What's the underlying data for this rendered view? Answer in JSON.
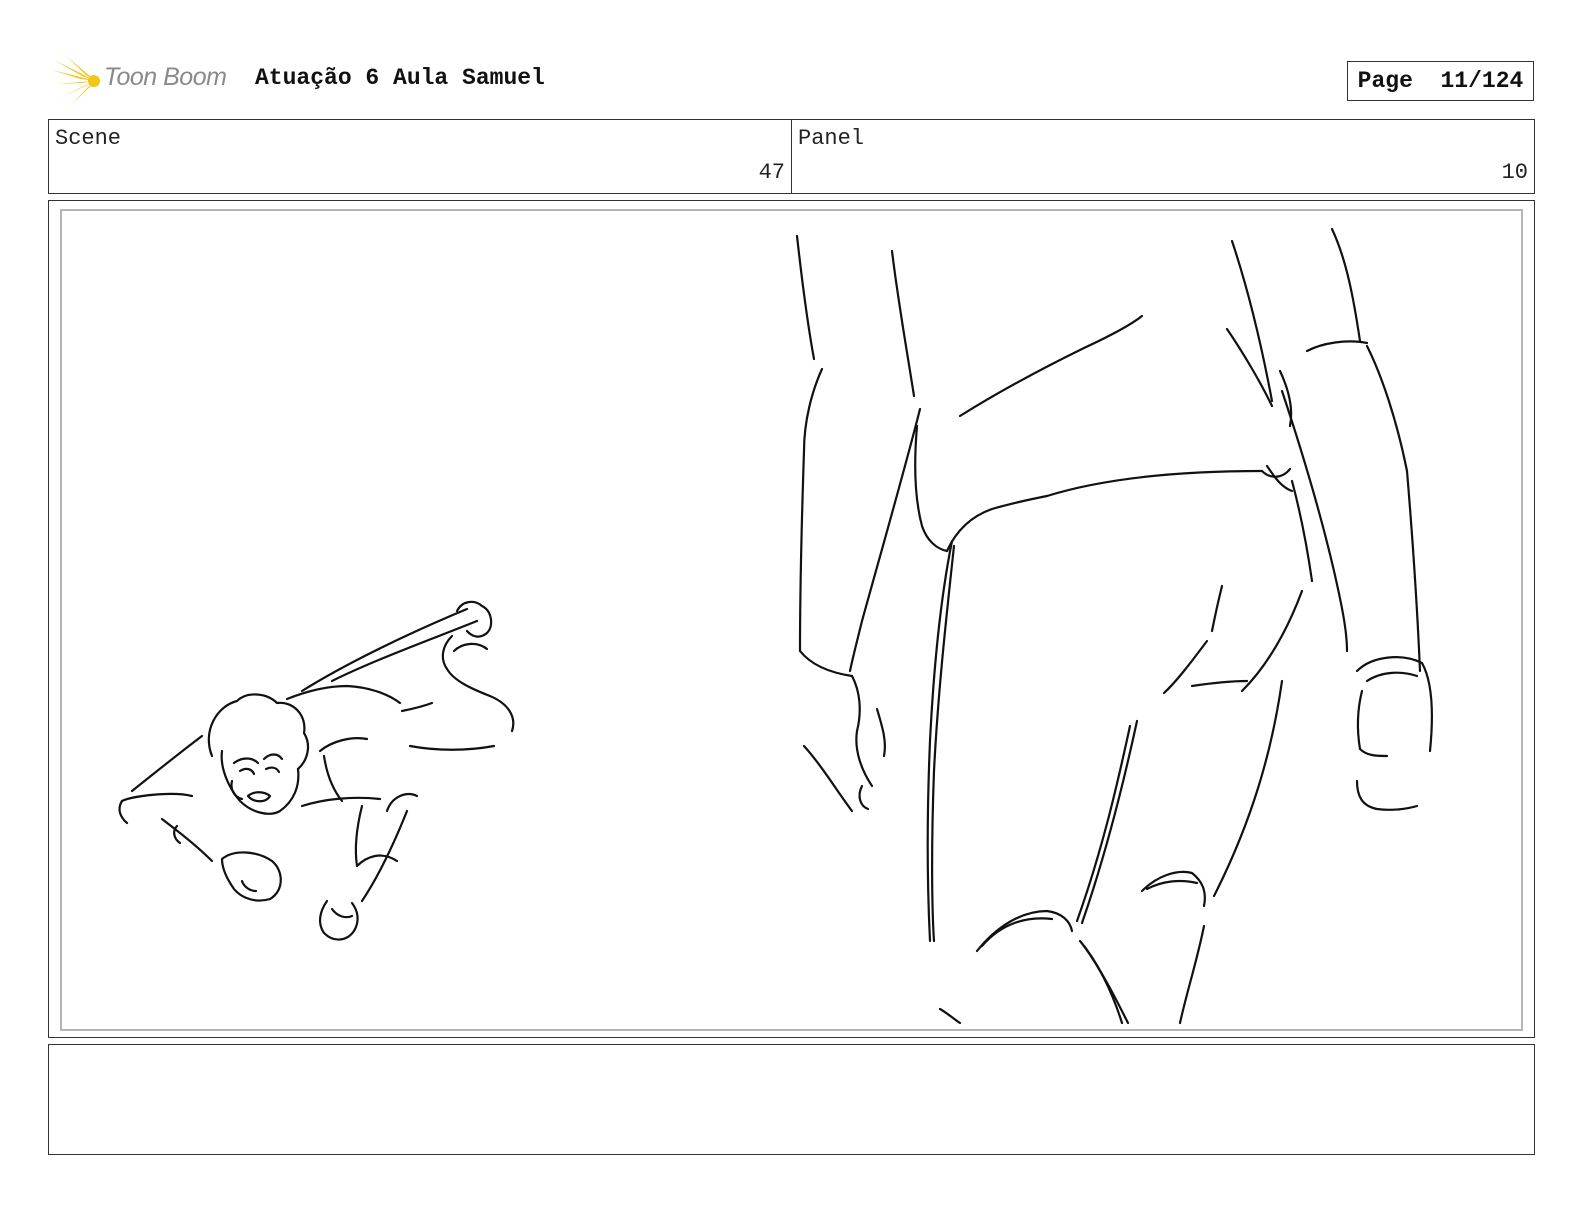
{
  "header": {
    "logo_text": "Toon Boom",
    "title": "Atuação 6 Aula Samuel",
    "page_label": "Page",
    "page_value": "11/124"
  },
  "info": {
    "scene_label": "Scene",
    "scene_value": "47",
    "panel_label": "Panel",
    "panel_value": "10"
  },
  "notes": {
    "text": ""
  },
  "colors": {
    "logo_accent": "#f5c518",
    "ink": "#111111",
    "frame_border": "#333333",
    "inner_border": "#b5b5b5"
  },
  "icons": {
    "logo": "toon-boom-burst-icon"
  }
}
